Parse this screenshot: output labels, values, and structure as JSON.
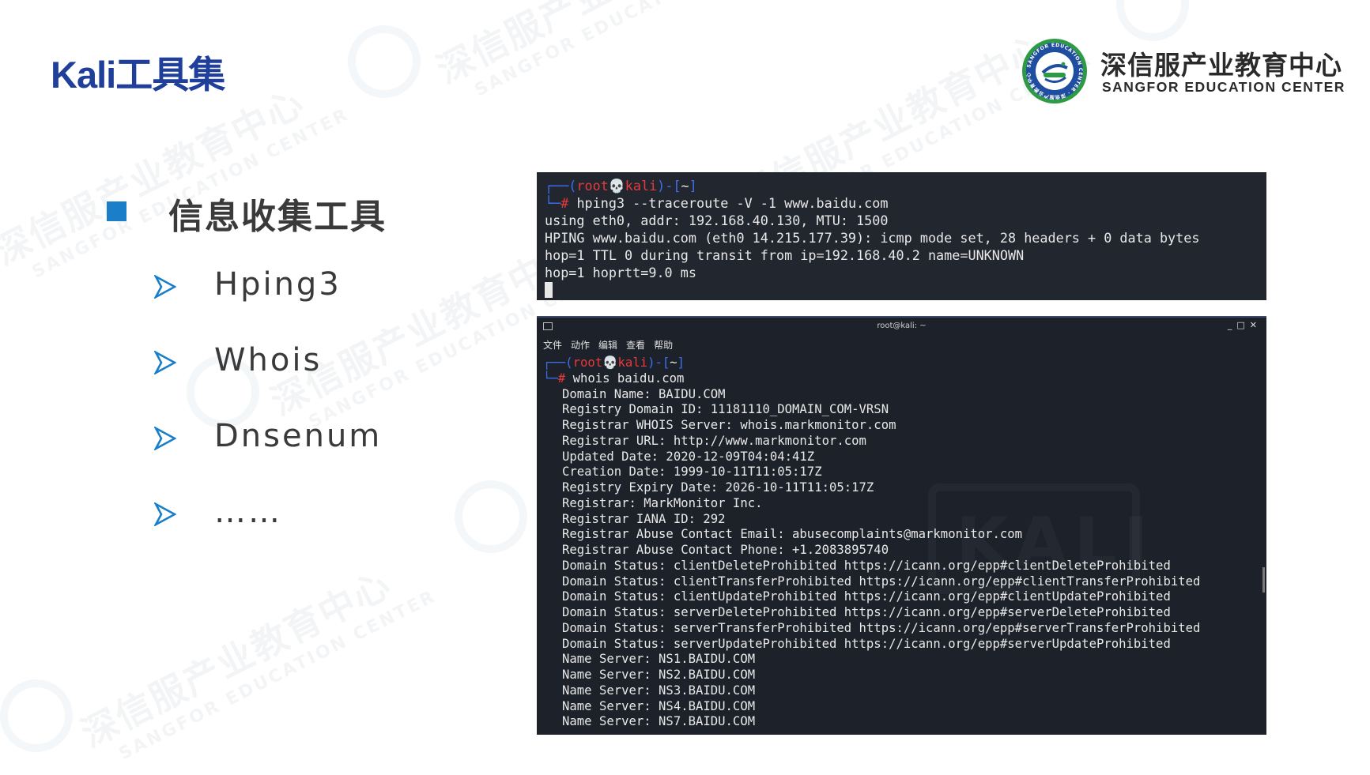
{
  "slide": {
    "title": "Kali工具集",
    "section_title": "信息收集工具",
    "tools": [
      "Hping3",
      "Whois",
      "Dnsenum",
      "……"
    ]
  },
  "logo": {
    "name_cn": "深信服产业教育中心",
    "name_en": "SANGFOR EDUCATION CENTER",
    "emblem_text": "SANGFOR EDUCATION CENTER · 深信服产业教育中心"
  },
  "watermark": {
    "text_cn": "深信服产业教育中心",
    "text_en": "SANGFOR EDUCATION CENTER"
  },
  "terminal_hping": {
    "prompt_user": "root",
    "prompt_skull": "💀",
    "prompt_host": "kali",
    "prompt_dir": "~",
    "command": "hping3 --traceroute -V -1 www.baidu.com",
    "output": [
      "using eth0, addr: 192.168.40.130, MTU: 1500",
      "HPING www.baidu.com (eth0 14.215.177.39): icmp mode set, 28 headers + 0 data bytes",
      "hop=1 TTL 0 during transit from ip=192.168.40.2 name=UNKNOWN",
      "hop=1 hoprtt=9.0 ms"
    ]
  },
  "terminal_whois": {
    "window_title": "root@kali: ~",
    "window_controls": [
      "_",
      "□",
      "✕"
    ],
    "menu": [
      "文件",
      "动作",
      "编辑",
      "查看",
      "帮助"
    ],
    "prompt_user": "root",
    "prompt_skull": "💀",
    "prompt_host": "kali",
    "prompt_dir": "~",
    "command": "whois baidu.com",
    "watermark_text": "KALI",
    "output": [
      "Domain Name: BAIDU.COM",
      "Registry Domain ID: 11181110_DOMAIN_COM-VRSN",
      "Registrar WHOIS Server: whois.markmonitor.com",
      "Registrar URL: http://www.markmonitor.com",
      "Updated Date: 2020-12-09T04:04:41Z",
      "Creation Date: 1999-10-11T11:05:17Z",
      "Registry Expiry Date: 2026-10-11T11:05:17Z",
      "Registrar: MarkMonitor Inc.",
      "Registrar IANA ID: 292",
      "Registrar Abuse Contact Email: abusecomplaints@markmonitor.com",
      "Registrar Abuse Contact Phone: +1.2083895740",
      "Domain Status: clientDeleteProhibited https://icann.org/epp#clientDeleteProhibited",
      "Domain Status: clientTransferProhibited https://icann.org/epp#clientTransferProhibited",
      "Domain Status: clientUpdateProhibited https://icann.org/epp#clientUpdateProhibited",
      "Domain Status: serverDeleteProhibited https://icann.org/epp#serverDeleteProhibited",
      "Domain Status: serverTransferProhibited https://icann.org/epp#serverTransferProhibited",
      "Domain Status: serverUpdateProhibited https://icann.org/epp#serverUpdateProhibited",
      "Name Server: NS1.BAIDU.COM",
      "Name Server: NS2.BAIDU.COM",
      "Name Server: NS3.BAIDU.COM",
      "Name Server: NS4.BAIDU.COM",
      "Name Server: NS7.BAIDU.COM"
    ]
  },
  "colors": {
    "title_blue": "#1f3f9a",
    "bullet_blue": "#1a7fc8",
    "terminal_bg": "#1d2129",
    "prompt_red": "#e8393c",
    "prompt_blue": "#3c6ff0",
    "logo_green": "#2e9a45"
  }
}
